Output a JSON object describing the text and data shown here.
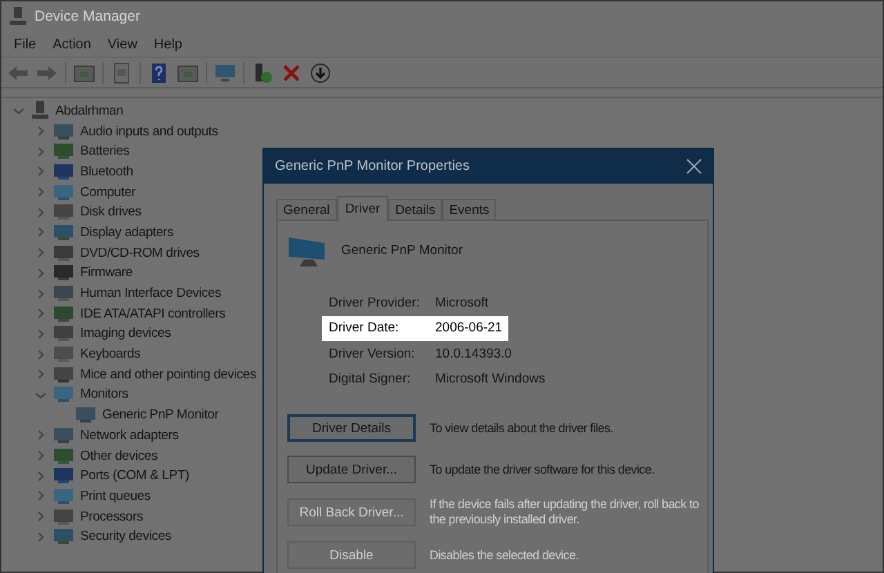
{
  "window": {
    "title": "Device Manager"
  },
  "menu": [
    {
      "label": "File"
    },
    {
      "label": "Action"
    },
    {
      "label": "View"
    },
    {
      "label": "Help"
    }
  ],
  "tree": {
    "label": "Abdalrhman",
    "expanded": true,
    "children": [
      {
        "label": "Audio inputs and outputs",
        "expanded": false
      },
      {
        "label": "Batteries",
        "expanded": false
      },
      {
        "label": "Bluetooth",
        "expanded": false
      },
      {
        "label": "Computer",
        "expanded": false
      },
      {
        "label": "Disk drives",
        "expanded": false
      },
      {
        "label": "Display adapters",
        "expanded": false
      },
      {
        "label": "DVD/CD-ROM drives",
        "expanded": false
      },
      {
        "label": "Firmware",
        "expanded": false
      },
      {
        "label": "Human Interface Devices",
        "expanded": false
      },
      {
        "label": "IDE ATA/ATAPI controllers",
        "expanded": false
      },
      {
        "label": "Imaging devices",
        "expanded": false
      },
      {
        "label": "Keyboards",
        "expanded": false
      },
      {
        "label": "Mice and other pointing devices",
        "expanded": false
      },
      {
        "label": "Monitors",
        "expanded": true,
        "children": [
          {
            "label": "Generic PnP Monitor"
          }
        ]
      },
      {
        "label": "Network adapters",
        "expanded": false
      },
      {
        "label": "Other devices",
        "expanded": false
      },
      {
        "label": "Ports (COM & LPT)",
        "expanded": false
      },
      {
        "label": "Print queues",
        "expanded": false
      },
      {
        "label": "Processors",
        "expanded": false
      },
      {
        "label": "Security devices",
        "expanded": false
      }
    ]
  },
  "dialog": {
    "title": "Generic PnP Monitor Properties",
    "tabs": [
      {
        "label": "General",
        "selected": false
      },
      {
        "label": "Driver",
        "selected": true
      },
      {
        "label": "Details",
        "selected": false
      },
      {
        "label": "Events",
        "selected": false
      }
    ],
    "device_name": "Generic PnP Monitor",
    "fields": [
      {
        "label": "Driver Provider:",
        "value": "Microsoft",
        "highlighted": false
      },
      {
        "label": "Driver Date:",
        "value": "2006-06-21",
        "highlighted": true
      },
      {
        "label": "Driver Version:",
        "value": "10.0.14393.0",
        "highlighted": false
      },
      {
        "label": "Digital Signer:",
        "value": "Microsoft Windows",
        "highlighted": false
      }
    ],
    "actions": [
      {
        "button": "Driver Details",
        "description": "To view details about the driver files.",
        "disabled": false,
        "default": true
      },
      {
        "button": "Update Driver...",
        "description": "To update the driver software for this device.",
        "disabled": false,
        "default": false
      },
      {
        "button": "Roll Back Driver...",
        "description": "If the device fails after updating the driver, roll back to the previously installed driver.",
        "disabled": true,
        "default": false
      },
      {
        "button": "Disable",
        "description": "Disables the selected device.",
        "disabled": true,
        "default": false
      }
    ]
  }
}
